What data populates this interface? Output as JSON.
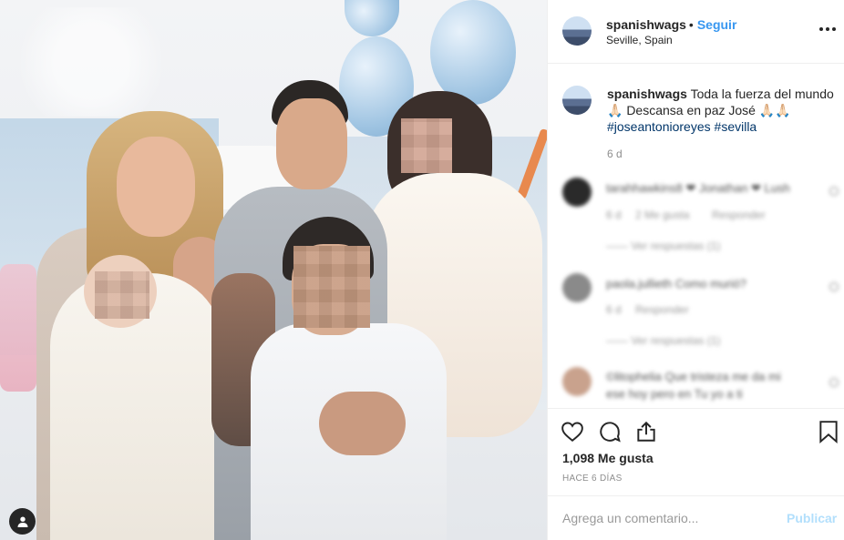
{
  "post": {
    "username": "spanishwags",
    "separator": "•",
    "follow_label": "Seguir",
    "location": "Seville, Spain",
    "caption_body": "Toda la fuerza del mundo 🙏🏻 Descansa en paz José 🙏🏻🙏🏻",
    "hashtags": [
      "#joseantonioreyes",
      "#sevilla"
    ],
    "caption_time": "6 d",
    "likes_text": "1,098 Me gusta",
    "posted_ago": "HACE 6 DÍAS",
    "comment_placeholder": "Agrega un comentario...",
    "publish_label": "Publicar"
  },
  "blurred_comments": [
    {
      "line": "tarahhawkins8 ❤ Jonathan ❤ Lush",
      "meta": [
        "6 d",
        "2 Me gusta",
        "Responder"
      ],
      "replies": "Ver respuestas (1)"
    },
    {
      "line": "paola.jullieth Como murió?",
      "meta": [
        "6 d",
        "Responder"
      ],
      "replies": "Ver respuestas (1)"
    },
    {
      "line": "©litophelia Que tristeza me da mi",
      "line2": "ese hoy pero en Tu yo a ti"
    }
  ],
  "icons": {
    "more": "more-options-icon",
    "like": "heart-icon",
    "comment": "comment-icon",
    "share": "share-icon",
    "save": "bookmark-icon",
    "tag": "user-tag-icon"
  },
  "colors": {
    "accent": "#3897f0",
    "hashtag": "#003569",
    "muted": "#8e8e8e",
    "publish_disabled": "#b2dffc"
  }
}
